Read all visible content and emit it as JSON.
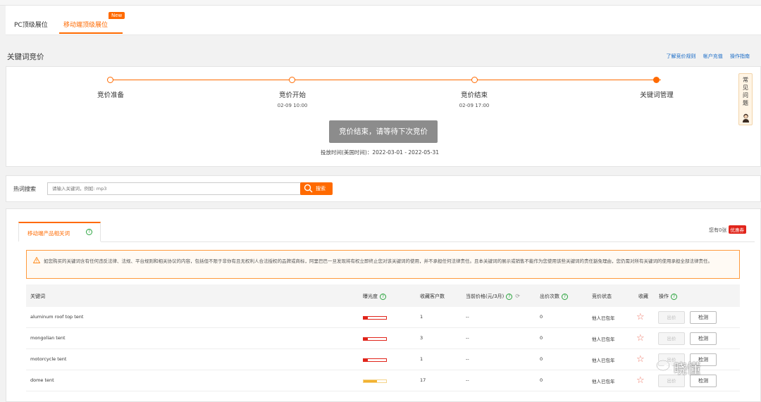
{
  "tabs": [
    {
      "label": "PC顶级展位",
      "active": false
    },
    {
      "label": "移动端顶级展位",
      "active": true,
      "badge": "New"
    }
  ],
  "section": {
    "title": "关键词竞价",
    "links": [
      "了解竞价规则",
      "帐户充值",
      "操作指南"
    ]
  },
  "progress": {
    "steps": [
      {
        "label": "竞价准备",
        "time": "",
        "state": "done"
      },
      {
        "label": "竞价开始",
        "time": "02-09 10:00",
        "state": "done"
      },
      {
        "label": "竞价结束",
        "time": "02-09 17:00",
        "state": "done"
      },
      {
        "label": "关键词管理",
        "time": "",
        "state": "current"
      }
    ],
    "status": "竞价结束，请等待下次竞价",
    "delivery_time": "投放时间(美国时间)：2022-03-01 - 2022-05-31"
  },
  "faq": {
    "label": "常见问题"
  },
  "search": {
    "label": "热词搜索",
    "placeholder": "请输入关键词，例如: mp3",
    "button": "搜索"
  },
  "category": {
    "tab_label": "移动端产品相关词",
    "remaining_label": "您有0张",
    "coupon": "优惠券"
  },
  "notice": "如您购买的关键词含有任何违反法律、法规、平台规则和相关协议的内容，包括但不限于非你有且无权利人合法授权的品牌或商标，阿里巴巴一旦发现将有权立即终止您对该关键词的使用，并不承担任何法律责任。且本关键词的展示或销售不能作为您使用该些关键词的责任豁免理由，您仍需对所有关键词的使用承担全部法律责任。",
  "table": {
    "headers": {
      "keyword": "关键词",
      "exposure": "曝光度",
      "favorites": "收藏客户数",
      "price": "当前价格(元/3月)",
      "bids": "出价次数",
      "status": "竞价状态",
      "collect": "收藏",
      "ops": "操作"
    },
    "rows": [
      {
        "keyword": "aluminum roof top tent",
        "exposure": 0.2,
        "exposure_color": "red",
        "favorites": "1",
        "price": "--",
        "bids": "0",
        "status": "他人已包年",
        "op1": "出价",
        "op2": "检测"
      },
      {
        "keyword": "mongolian tent",
        "exposure": 0.2,
        "exposure_color": "red",
        "favorites": "3",
        "price": "--",
        "bids": "0",
        "status": "他人已包年",
        "op1": "出价",
        "op2": "检测"
      },
      {
        "keyword": "motorcycle tent",
        "exposure": 0.2,
        "exposure_color": "red",
        "favorites": "1",
        "price": "--",
        "bids": "0",
        "status": "他人已包年",
        "op1": "出价",
        "op2": "检测"
      },
      {
        "keyword": "dome tent",
        "exposure": 0.6,
        "exposure_color": "yellow",
        "favorites": "17",
        "price": "--",
        "bids": "0",
        "status": "他人已包年",
        "op1": "出价",
        "op2": "检测"
      }
    ]
  },
  "watermark": "晓懂",
  "colors": {
    "accent": "#ff6a00",
    "link": "#1a6cc7",
    "danger": "#e1251b",
    "help": "#2ca53f"
  }
}
